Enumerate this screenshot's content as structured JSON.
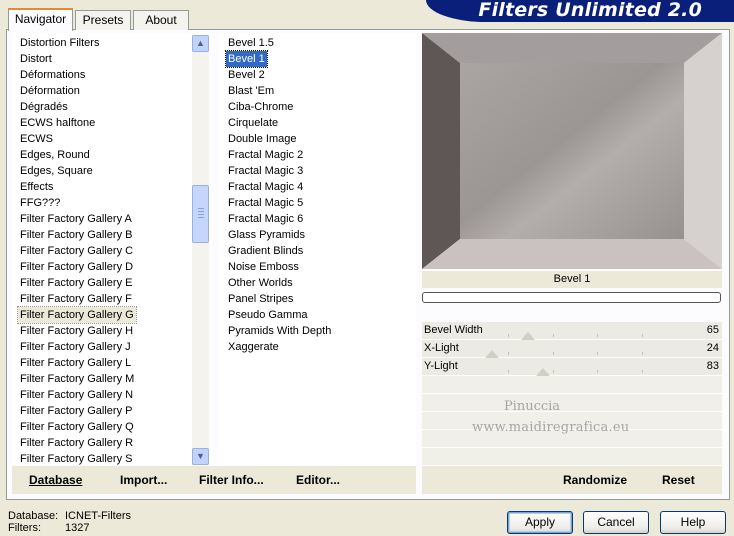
{
  "app_title": "Filters Unlimited 2.0",
  "tabs": [
    {
      "label": "Navigator",
      "active": true
    },
    {
      "label": "Presets",
      "active": false
    },
    {
      "label": "About",
      "active": false
    }
  ],
  "categories": {
    "selected": "Filter Factory Gallery G",
    "items": [
      "Distortion Filters",
      "Distort",
      "Déformations",
      "Déformation",
      "Dégradés",
      "ECWS halftone",
      "ECWS",
      "Edges, Round",
      "Edges, Square",
      "Effects",
      "FFG???",
      "Filter Factory Gallery A",
      "Filter Factory Gallery B",
      "Filter Factory Gallery C",
      "Filter Factory Gallery D",
      "Filter Factory Gallery E",
      "Filter Factory Gallery F",
      "Filter Factory Gallery G",
      "Filter Factory Gallery H",
      "Filter Factory Gallery J",
      "Filter Factory Gallery L",
      "Filter Factory Gallery M",
      "Filter Factory Gallery N",
      "Filter Factory Gallery P",
      "Filter Factory Gallery Q",
      "Filter Factory Gallery R",
      "Filter Factory Gallery S"
    ]
  },
  "filters": {
    "selected": "Bevel 1",
    "items": [
      "Bevel 1.5",
      "Bevel 1",
      "Bevel 2",
      "Blast 'Em",
      "Ciba-Chrome",
      "Cirquelate",
      "Double Image",
      "Fractal Magic 2",
      "Fractal Magic 3",
      "Fractal Magic 4",
      "Fractal Magic 5",
      "Fractal Magic 6",
      "Glass Pyramids",
      "Gradient Blinds",
      "Noise Emboss",
      "Other Worlds",
      "Panel Stripes",
      "Pseudo Gamma",
      "Pyramids With Depth",
      "Xaggerate"
    ]
  },
  "toolbar": {
    "database_label": "Database",
    "import_label": "Import...",
    "filter_info_label": "Filter Info...",
    "editor_label": "Editor..."
  },
  "preview": {
    "filter_name": "Bevel 1",
    "colors": {
      "center": "#a09c9a",
      "top": "#a39e9d",
      "left": "#5e5756",
      "right": "#d6d1cf",
      "bottom": "#c9c2c0"
    }
  },
  "params": [
    {
      "label": "Bevel Width",
      "value": "65",
      "level": 0.255
    },
    {
      "label": "X-Light",
      "value": "24",
      "level": 0.094
    },
    {
      "label": "Y-Light",
      "value": "83",
      "level": 0.325
    }
  ],
  "watermark": {
    "line1": "Pinuccia",
    "line2": "www.maidiregrafica.eu"
  },
  "right_toolbar": {
    "randomize_label": "Randomize",
    "reset_label": "Reset"
  },
  "info": {
    "database_key": "Database:",
    "database_value": "ICNET-Filters",
    "filters_key": "Filters:",
    "filters_value": "1327"
  },
  "buttons": {
    "apply": "Apply",
    "cancel": "Cancel",
    "help": "Help"
  }
}
